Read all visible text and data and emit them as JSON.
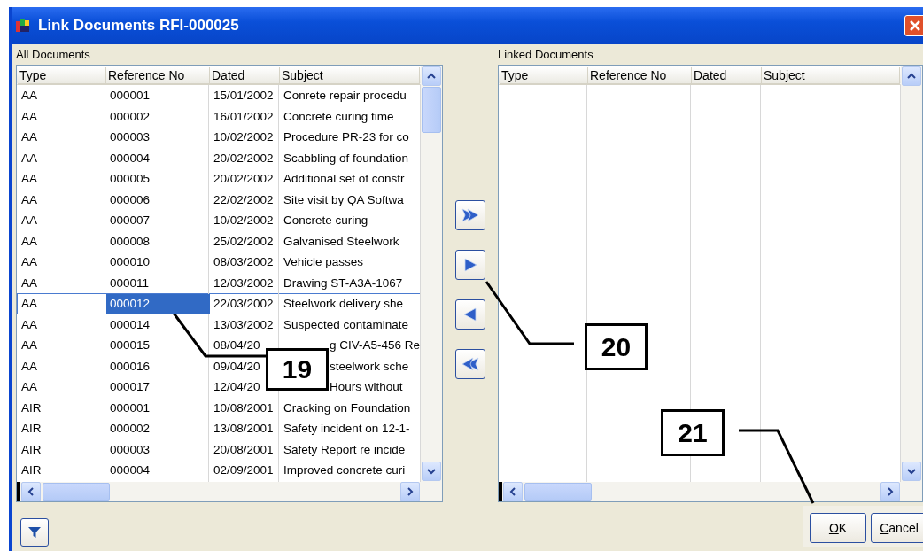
{
  "window": {
    "title": "Link Documents RFI-000025"
  },
  "all_documents": {
    "label": "All Documents",
    "columns": [
      "Type",
      "Reference No",
      "Dated",
      "Subject"
    ],
    "rows": [
      {
        "cells": [
          "AA",
          "000001",
          "15/01/2002",
          "Conrete repair procedu"
        ],
        "selected": false
      },
      {
        "cells": [
          "AA",
          "000002",
          "16/01/2002",
          "Concrete curing time"
        ],
        "selected": false
      },
      {
        "cells": [
          "AA",
          "000003",
          "10/02/2002",
          "Procedure PR-23 for co"
        ],
        "selected": false
      },
      {
        "cells": [
          "AA",
          "000004",
          "20/02/2002",
          "Scabbling of foundation"
        ],
        "selected": false
      },
      {
        "cells": [
          "AA",
          "000005",
          "20/02/2002",
          "Additional set of constr"
        ],
        "selected": false
      },
      {
        "cells": [
          "AA",
          "000006",
          "22/02/2002",
          "Site visit by QA Softwa"
        ],
        "selected": false
      },
      {
        "cells": [
          "AA",
          "000007",
          "10/02/2002",
          "Concrete curing"
        ],
        "selected": false
      },
      {
        "cells": [
          "AA",
          "000008",
          "25/02/2002",
          "Galvanised Steelwork"
        ],
        "selected": false
      },
      {
        "cells": [
          "AA",
          "000010",
          "08/03/2002",
          "Vehicle passes"
        ],
        "selected": false
      },
      {
        "cells": [
          "AA",
          "000011",
          "12/03/2002",
          "Drawing ST-A3A-1067"
        ],
        "selected": false
      },
      {
        "cells": [
          "AA",
          "000012",
          "22/03/2002",
          "Steelwork delivery she"
        ],
        "selected": true
      },
      {
        "cells": [
          "AA",
          "000014",
          "13/03/2002",
          "Suspected contaminate"
        ],
        "selected": false
      },
      {
        "cells": [
          "AA",
          "000015",
          "08/04/20",
          "g CIV-A5-456 Re"
        ],
        "selected": false,
        "covered": true
      },
      {
        "cells": [
          "AA",
          "000016",
          "09/04/20",
          "steelwork sche"
        ],
        "selected": false,
        "covered": true
      },
      {
        "cells": [
          "AA",
          "000017",
          "12/04/20",
          "Hours without"
        ],
        "selected": false,
        "covered": true
      },
      {
        "cells": [
          "AIR",
          "000001",
          "10/08/2001",
          "Cracking on Foundation"
        ],
        "selected": false
      },
      {
        "cells": [
          "AIR",
          "000002",
          "13/08/2001",
          "Safety incident on 12-1-"
        ],
        "selected": false
      },
      {
        "cells": [
          "AIR",
          "000003",
          "20/08/2001",
          "Safety Report re incide"
        ],
        "selected": false
      },
      {
        "cells": [
          "AIR",
          "000004",
          "02/09/2001",
          "Improved concrete curi"
        ],
        "selected": false
      }
    ]
  },
  "linked_documents": {
    "label": "Linked Documents",
    "columns": [
      "Type",
      "Reference No",
      "Dated",
      "Subject"
    ]
  },
  "move_buttons": [
    {
      "kind": "all-right"
    },
    {
      "kind": "right"
    },
    {
      "kind": "left"
    },
    {
      "kind": "all-left"
    }
  ],
  "buttons": [
    {
      "label": "OK"
    },
    {
      "label": "Cancel"
    }
  ],
  "callouts": [
    {
      "label": "19"
    },
    {
      "label": "20"
    },
    {
      "label": "21"
    }
  ]
}
